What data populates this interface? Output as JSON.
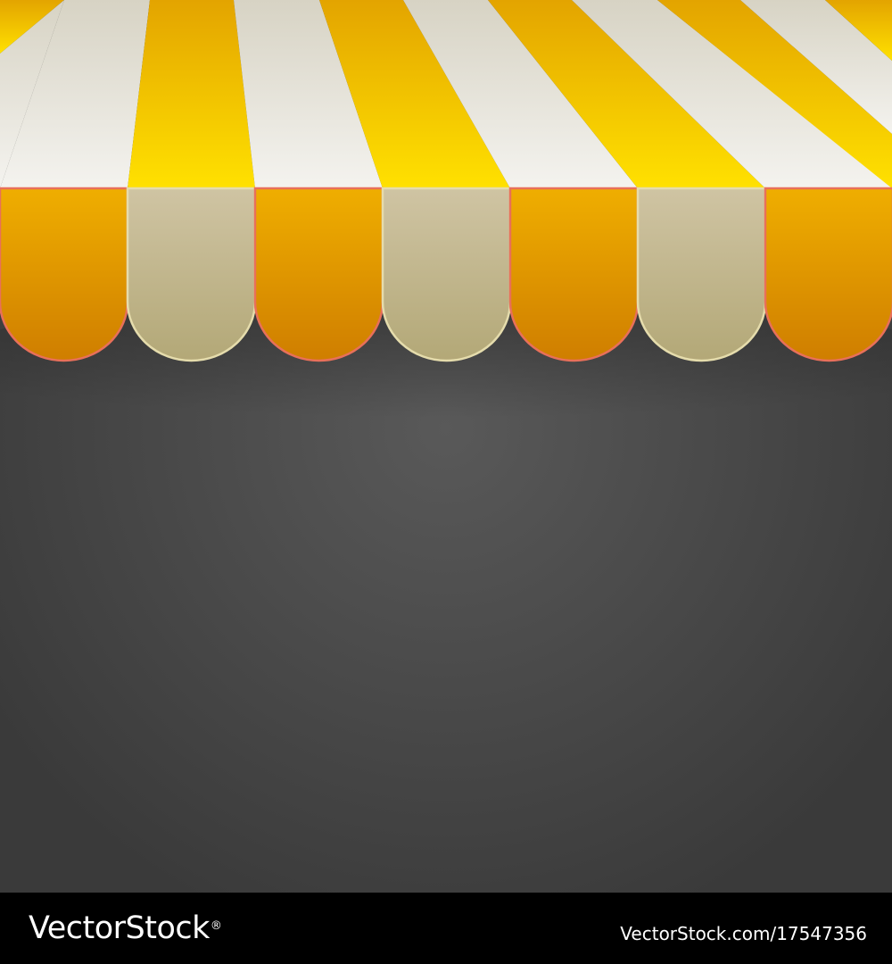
{
  "footer": {
    "brand": "VectorStock",
    "brand_mark": "®",
    "image_id": "VectorStock.com/17547356"
  },
  "colors": {
    "backdrop": "#3d3d3d",
    "backdrop_highlight": "#595959",
    "footer": "#000000",
    "stripe_yellow": "#f5c400",
    "stripe_white": "#eeede9",
    "flap_yellow": "#e09b00",
    "flap_cream": "#c6ba95"
  }
}
